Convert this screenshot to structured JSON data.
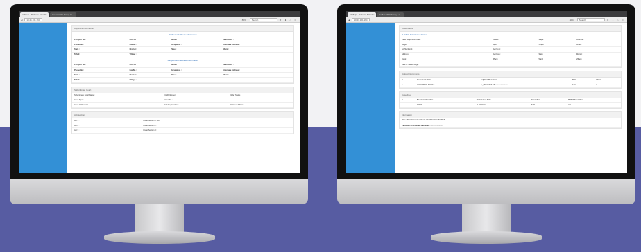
{
  "background": {
    "top": "#f2f2f4",
    "bottom": "#575ca2"
  },
  "accent": "#3390d6",
  "browser": {
    "tabs": [
      "wITSup - Defence Standar",
      "Indian CEP Jersey Ls..."
    ],
    "url": "10.21.161.164",
    "zoom": "80%",
    "search_placeholder": "Search",
    "toolbar_icons": "★ ⬇ ⌂ ☰"
  },
  "left": {
    "panel1": {
      "header": "Applicant Information",
      "sub1": "Petitioner Address Information",
      "grid1": [
        [
          "Passport No :",
          "PAN No :",
          "Gender :",
          "Nationality :"
        ],
        [
          "Phone No :",
          "Fax No :",
          "Occupation :",
          "Alternate Address :"
        ],
        [
          "State :",
          "District :",
          "Place :",
          "Ward :"
        ],
        [
          "Tehsil :",
          "Village :",
          "",
          ""
        ]
      ],
      "sub2": "Respondent Address Information",
      "grid2": [
        [
          "Passport No :",
          "PAN No :",
          "Gender :",
          "Nationality :"
        ],
        [
          "Phone No :",
          "Fax No :",
          "Occupation :",
          "Alternate Address :"
        ],
        [
          "State :",
          "District :",
          "Place :",
          "Ward :"
        ],
        [
          "Tehsil :",
          "Village :",
          "",
          ""
        ]
      ]
    },
    "panel2": {
      "header": "Subordinate Court",
      "rows": [
        [
          "Subordinate Court Name :",
          "CNR Number :",
          "Order Status :"
        ],
        [
          "Case Type :",
          "Case No :",
          ""
        ],
        [
          "Case Of Decision :",
          "FIR Registration :",
          "FIR Issued Date :"
        ]
      ]
    },
    "panel3": {
      "header": "Act/Section",
      "rows": [
        [
          "Act 1 :",
          "Under Section 1 : 00"
        ],
        [
          "Act 2 :",
          "Under Section 2 :"
        ],
        [
          "Act 3 :",
          "Under Section 3 :"
        ]
      ]
    }
  },
  "right": {
    "panel1": {
      "header": "Case Status",
      "sub": "1. MCC Transferred Status",
      "rows": [
        [
          "Case Registration Date:",
          "Status:",
          "Stage:",
          "Court No:"
        ],
        [
          "Stage:",
          "Age:",
          "Judge:",
          "Under:"
        ],
        [
          "Act/Section 1:",
          "Act No 1:",
          "",
          ""
        ],
        [
          "Address:",
          "Act Date:",
          "State:",
          "District:"
        ],
        [
          "Taluk:",
          "Place:",
          "Ward:",
          "Village:"
        ],
        [
          "Date of Status Stage:",
          "",
          "",
          ""
        ]
      ]
    },
    "panel2": {
      "header": "Upload Documents",
      "columns": [
        "#",
        "Document Name",
        "Upload Document",
        "Date",
        "Place"
      ],
      "rows": [
        [
          "1",
          "DOCUMENT ENTRY:",
          "▢ document link ........................",
          "6 / 3",
          "0"
        ]
      ]
    },
    "panel3": {
      "header": "Case Fee",
      "columns": [
        "#",
        "Document Number",
        "Transaction Date",
        "Court Fee",
        "Deficit Court Fee"
      ],
      "rows": [
        [
          "1",
          "00000",
          "11.10.2020",
          "8.20",
          "0.0"
        ]
      ]
    },
    "panel4": {
      "header": "Information",
      "lines": [
        "Date of Permission of Court / Certificate submitted: ........................",
        "Particular / Certificate submitted: ........................"
      ]
    }
  }
}
